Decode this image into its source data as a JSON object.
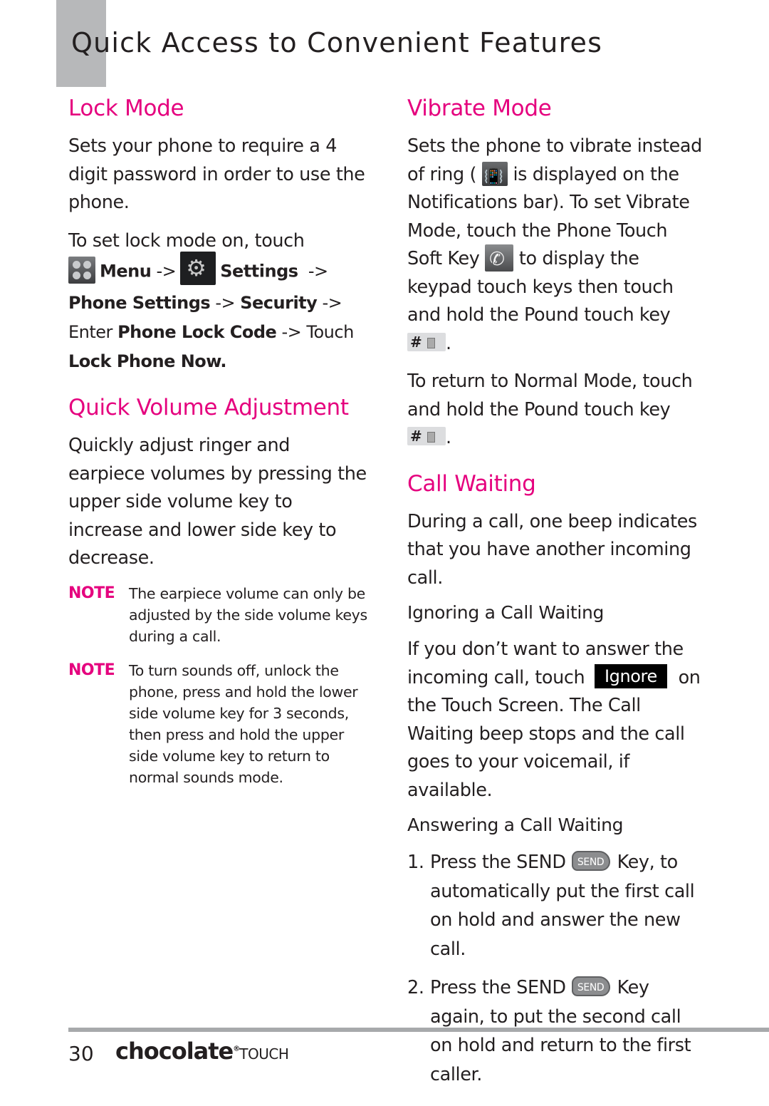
{
  "page": {
    "title": "Quick Access to Convenient Features",
    "page_number": "30",
    "brand": "chocolate",
    "brand_mark": "®",
    "brand_suffix": "TOUCH"
  },
  "colors": {
    "accent": "#e5007e",
    "text": "#231f20",
    "tab": "#b7b8ba"
  },
  "lock_mode": {
    "heading": "Lock Mode",
    "intro": "Sets your phone to require a 4 digit password in order to use the phone.",
    "lead": "To set lock mode on, touch",
    "steps": {
      "menu_icon": "menu-grid-icon",
      "menu": "Menu",
      "arrow": "->",
      "settings_icon": "gear-icon",
      "settings": "Settings",
      "phone_settings": "Phone Settings",
      "security": "Security",
      "enter": "Enter",
      "lock_code": "Phone Lock Code",
      "touch": "Touch",
      "lock_now": "Lock Phone Now."
    }
  },
  "quick_volume": {
    "heading": "Quick Volume Adjustment",
    "body": "Quickly adjust ringer and earpiece volumes by pressing the upper side volume key to increase and lower side key to decrease.",
    "notes": [
      {
        "label": "NOTE",
        "text": "The earpiece volume can only be adjusted by the side volume keys during a call."
      },
      {
        "label": "NOTE",
        "text": "To turn sounds off, unlock the phone, press and hold the lower side volume key for 3 seconds, then press and hold the upper side volume key to return to normal sounds mode."
      }
    ]
  },
  "vibrate_mode": {
    "heading": "Vibrate Mode",
    "p1_a": "Sets the phone to vibrate instead of ring (",
    "p1_b": "is displayed on the Notifications bar). To set Vibrate Mode, touch the Phone Touch Soft Key",
    "p1_c": "to display the keypad touch keys then touch and hold the Pound touch key",
    "p1_d": ".",
    "p2": "To return to Normal Mode, touch and hold the Pound touch key",
    "p2_end": ".",
    "pound_symbol": "#",
    "vibrate_icon": "vibrate-icon",
    "phone_icon": "phone-soft-key-icon"
  },
  "call_waiting": {
    "heading": "Call Waiting",
    "intro": "During a call, one beep indicates that you have another incoming call.",
    "ignoring": {
      "subheading": "Ignoring a Call Waiting",
      "text_a": "If you don’t want to answer the incoming call, touch",
      "button": "Ignore",
      "text_b": "on the Touch Screen. The Call Waiting beep stops and the call goes to your voicemail, if available."
    },
    "answering": {
      "subheading": "Answering a Call Waiting",
      "send_key": "SEND",
      "steps": [
        {
          "num": "1.",
          "a": "Press the SEND",
          "b": "Key, to automatically put the first call on hold and answer the new call."
        },
        {
          "num": "2.",
          "a": "Press the SEND",
          "b": "Key again, to put the second call on hold and return to the first caller."
        }
      ]
    }
  }
}
